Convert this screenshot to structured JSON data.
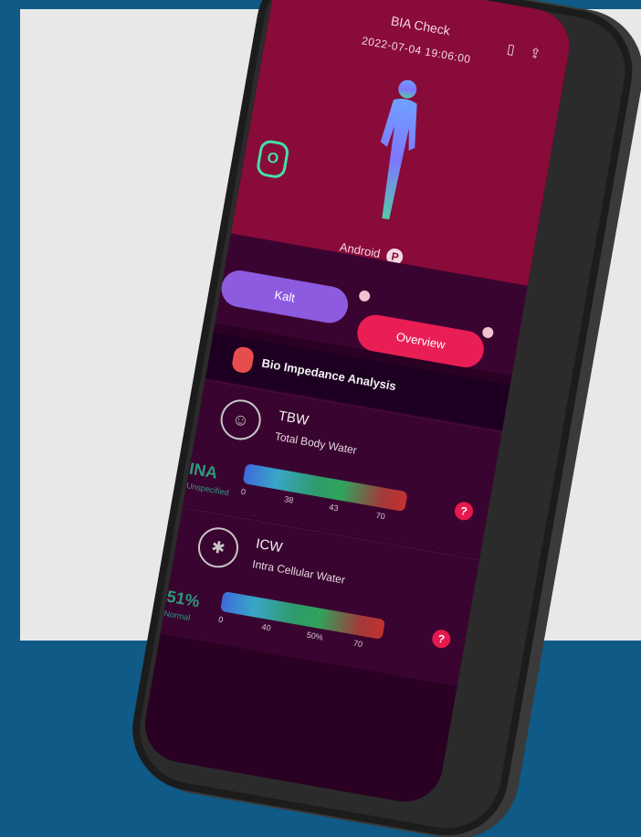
{
  "screen": {
    "title": "BIA Check",
    "datetime": "2022-07-04 19:06:00",
    "body_model_label": "Android",
    "tabs": [
      {
        "label": "Kalt"
      },
      {
        "label": "Overview"
      }
    ],
    "section_title": "Bio Impedance Analysis"
  },
  "metrics": [
    {
      "code": "TBW",
      "name": "Total Body Water",
      "value": "INA",
      "value_sub": "Unspecified",
      "ticks": [
        "0",
        "38",
        "43",
        "70"
      ]
    },
    {
      "code": "ICW",
      "name": "Intra Cellular Water",
      "value": "51%",
      "value_sub": "Normal",
      "ticks": [
        "0",
        "40",
        "50%",
        "70"
      ]
    }
  ],
  "colors": {
    "page_bg": "#0f5a86",
    "panel_bg": "#e8e8e8",
    "hero": "#880b3a",
    "accent_purple": "#8c5be0",
    "accent_pink": "#e91e55",
    "green_value": "#2c9c7b"
  },
  "icons": {
    "share": "share-icon",
    "document": "document-icon",
    "info": "info-icon",
    "help": "help-icon",
    "bia": "bia-icon",
    "tbw": "body-water-icon",
    "icw": "cell-water-icon"
  }
}
